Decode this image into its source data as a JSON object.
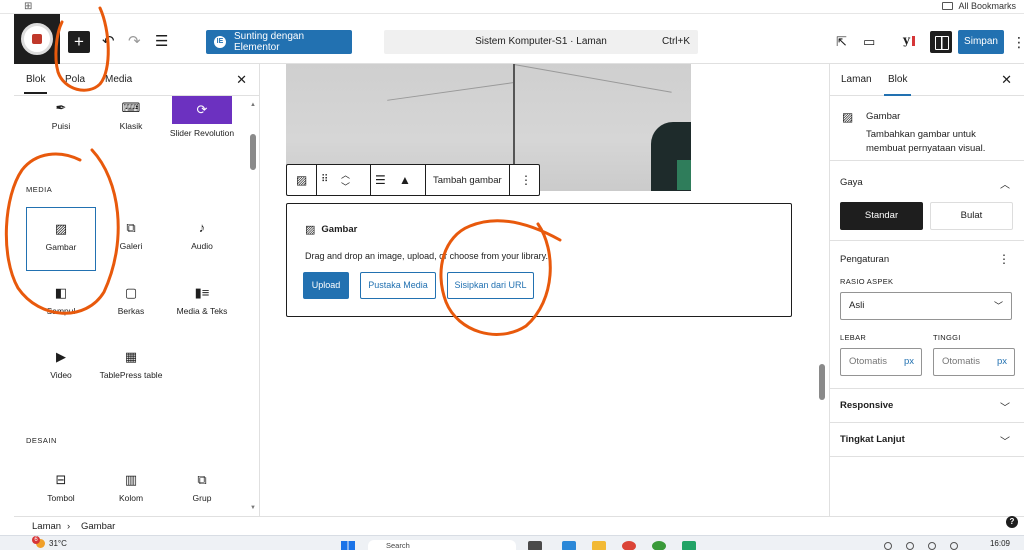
{
  "browser": {
    "all_bookmarks": "All Bookmarks"
  },
  "topbar": {
    "elementor_button": "Sunting dengan Elementor",
    "document_title": "Sistem Komputer-S1 · Laman",
    "shortcut": "Ctrl+K",
    "save_button": "Simpan"
  },
  "inserter": {
    "tabs": [
      "Blok",
      "Pola",
      "Media"
    ],
    "top_row": [
      {
        "label": "Puisi",
        "icon": "feather-icon"
      },
      {
        "label": "Klasik",
        "icon": "keyboard-icon"
      },
      {
        "label": "Slider Revolution",
        "icon": "slider-revolution-icon"
      }
    ],
    "media_section": "MEDIA",
    "media_blocks": [
      {
        "label": "Gambar",
        "icon": "image-icon"
      },
      {
        "label": "Galeri",
        "icon": "gallery-icon"
      },
      {
        "label": "Audio",
        "icon": "audio-icon"
      },
      {
        "label": "Sampul",
        "icon": "cover-icon"
      },
      {
        "label": "Berkas",
        "icon": "file-icon"
      },
      {
        "label": "Media & Teks",
        "icon": "media-text-icon"
      },
      {
        "label": "Video",
        "icon": "video-icon"
      },
      {
        "label": "TablePress table",
        "icon": "table-icon"
      }
    ],
    "design_section": "DESAIN",
    "design_blocks": [
      {
        "label": "Tombol",
        "icon": "buttons-icon"
      },
      {
        "label": "Kolom",
        "icon": "columns-icon"
      },
      {
        "label": "Grup",
        "icon": "group-icon"
      }
    ]
  },
  "canvas": {
    "block_toolbar": {
      "add_image": "Tambah gambar"
    },
    "placeholder": {
      "title": "Gambar",
      "description": "Drag and drop an image, upload, or choose from your library.",
      "upload": "Upload",
      "media_library": "Pustaka Media",
      "insert_url": "Sisipkan dari URL"
    }
  },
  "settings": {
    "tabs": [
      "Laman",
      "Blok"
    ],
    "block_name": "Gambar",
    "block_description": "Tambahkan gambar untuk membuat pernyataan visual.",
    "style_section": "Gaya",
    "style_options": [
      "Standar",
      "Bulat"
    ],
    "settings_section": "Pengaturan",
    "aspect_label": "RASIO ASPEK",
    "aspect_value": "Asli",
    "width_label": "LEBAR",
    "height_label": "TINGGI",
    "width_placeholder": "Otomatis",
    "height_placeholder": "Otomatis",
    "unit": "px",
    "responsive_section": "Responsive",
    "advanced_section": "Tingkat Lanjut"
  },
  "breadcrumb": [
    "Laman",
    "Gambar"
  ],
  "taskbar": {
    "weather_badge": "6",
    "temperature": "31°C",
    "search_placeholder": "Search",
    "time": "16:09"
  },
  "colors": {
    "accent": "#2271b1",
    "dark": "#1e1e1e",
    "annotation": "#e8590c"
  }
}
